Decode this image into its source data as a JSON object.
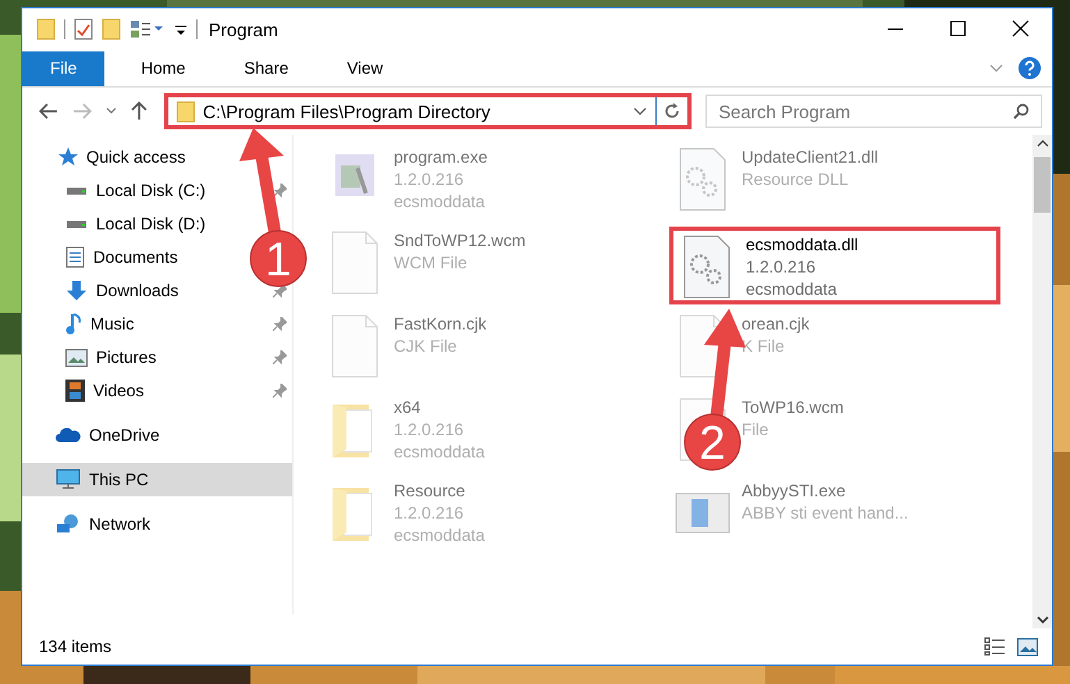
{
  "window": {
    "title": "Program"
  },
  "ribbon_tabs": [
    {
      "label": "File",
      "selected": true
    },
    {
      "label": "Home",
      "selected": false
    },
    {
      "label": "Share",
      "selected": false
    },
    {
      "label": "View",
      "selected": false
    }
  ],
  "address": {
    "path": "C:\\Program Files\\Program Directory",
    "highlighted": true
  },
  "search": {
    "placeholder": "Search Program"
  },
  "sidebar": {
    "items": [
      {
        "label": "Quick access",
        "kind": "star",
        "selected": false,
        "children": [
          {
            "label": "Local Disk (C:)",
            "kind": "drive",
            "pinned": true
          },
          {
            "label": "Local Disk (D:)",
            "kind": "drive",
            "pinned": false
          },
          {
            "label": "Documents",
            "kind": "docs",
            "pinned": false
          },
          {
            "label": "Downloads",
            "kind": "download",
            "pinned": true
          },
          {
            "label": "Music",
            "kind": "music",
            "pinned": true
          },
          {
            "label": "Pictures",
            "kind": "pictures",
            "pinned": true
          },
          {
            "label": "Videos",
            "kind": "videos",
            "pinned": true
          }
        ]
      },
      {
        "label": "OneDrive",
        "kind": "cloud",
        "selected": false
      },
      {
        "label": "This PC",
        "kind": "pc",
        "selected": true
      },
      {
        "label": "Network",
        "kind": "network",
        "selected": false
      }
    ]
  },
  "files": [
    {
      "name": "program.exe",
      "lines": [
        "1.2.0.216",
        "ecsmoddata"
      ],
      "kind": "exe",
      "blurred": true,
      "highlighted": false
    },
    {
      "name": "UpdateClient21.dll",
      "lines": [
        "Resource DLL"
      ],
      "kind": "dll",
      "blurred": true,
      "highlighted": false
    },
    {
      "name": "SndToWP12.wcm",
      "lines": [
        "WCM File"
      ],
      "kind": "file",
      "blurred": true,
      "highlighted": false
    },
    {
      "name": "ecsmoddata.dll",
      "lines": [
        "1.2.0.216",
        "ecsmoddata"
      ],
      "kind": "dll",
      "blurred": false,
      "highlighted": true
    },
    {
      "name": "FastKorn.cjk",
      "lines": [
        "CJK File"
      ],
      "kind": "file",
      "blurred": true,
      "highlighted": false
    },
    {
      "name": "orean.cjk",
      "lines": [
        "K File"
      ],
      "kind": "file",
      "blurred": true,
      "highlighted": false
    },
    {
      "name": "x64",
      "lines": [
        "1.2.0.216",
        "ecsmoddata"
      ],
      "kind": "folder",
      "blurred": true,
      "highlighted": false
    },
    {
      "name": "ToWP16.wcm",
      "lines": [
        "File"
      ],
      "kind": "file",
      "blurred": true,
      "highlighted": false
    },
    {
      "name": "Resource",
      "lines": [
        "1.2.0.216",
        "ecsmoddata"
      ],
      "kind": "folder",
      "blurred": true,
      "highlighted": false
    },
    {
      "name": "AbbyySTI.exe",
      "lines": [
        "ABBY sti event hand..."
      ],
      "kind": "app",
      "blurred": true,
      "highlighted": false
    }
  ],
  "status_bar": {
    "count": "134 items"
  },
  "annotations": [
    {
      "number": "1"
    },
    {
      "number": "2"
    }
  ]
}
